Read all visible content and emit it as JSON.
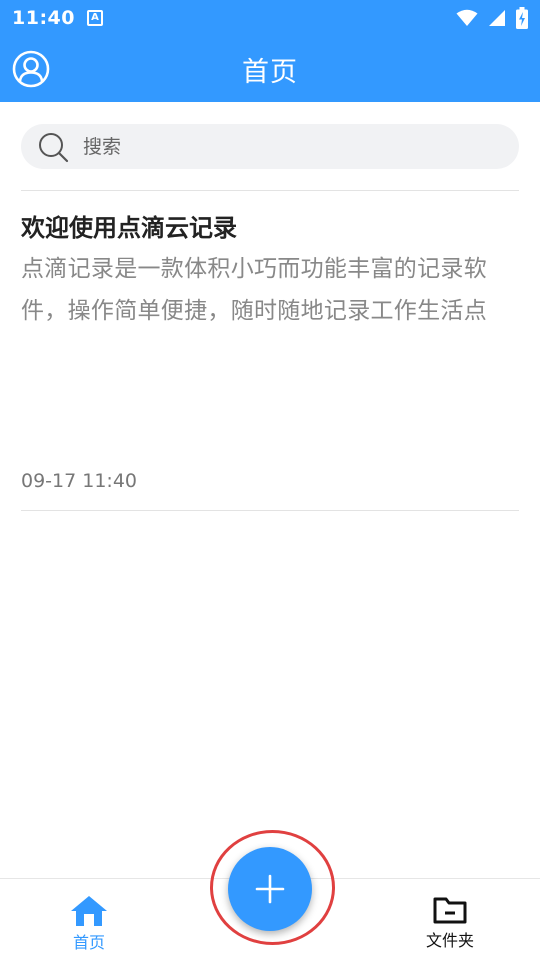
{
  "status_bar": {
    "time": "11:40",
    "notification_glyph": "A",
    "icons": [
      "wifi-icon",
      "signal-icon",
      "battery-icon"
    ]
  },
  "app_bar": {
    "title": "首页",
    "left_icon": "profile-icon"
  },
  "search": {
    "placeholder": "搜索",
    "value": ""
  },
  "notes": [
    {
      "title": "欢迎使用点滴云记录",
      "preview": "点滴记录是一款体积小巧而功能丰富的记录软件，操作简单便捷，随时随地记录工作生活点",
      "timestamp": "09-17 11:40"
    }
  ],
  "bottom_nav": {
    "items": [
      {
        "label": "首页",
        "icon": "home-icon",
        "active": true
      },
      {
        "label": "文件夹",
        "icon": "folder-icon",
        "active": false
      }
    ],
    "fab_icon": "plus-icon"
  },
  "colors": {
    "primary": "#3399ff",
    "highlight_ring": "#e04040",
    "search_bg": "#f1f2f4",
    "text_title": "#222222",
    "text_body": "#888888"
  }
}
